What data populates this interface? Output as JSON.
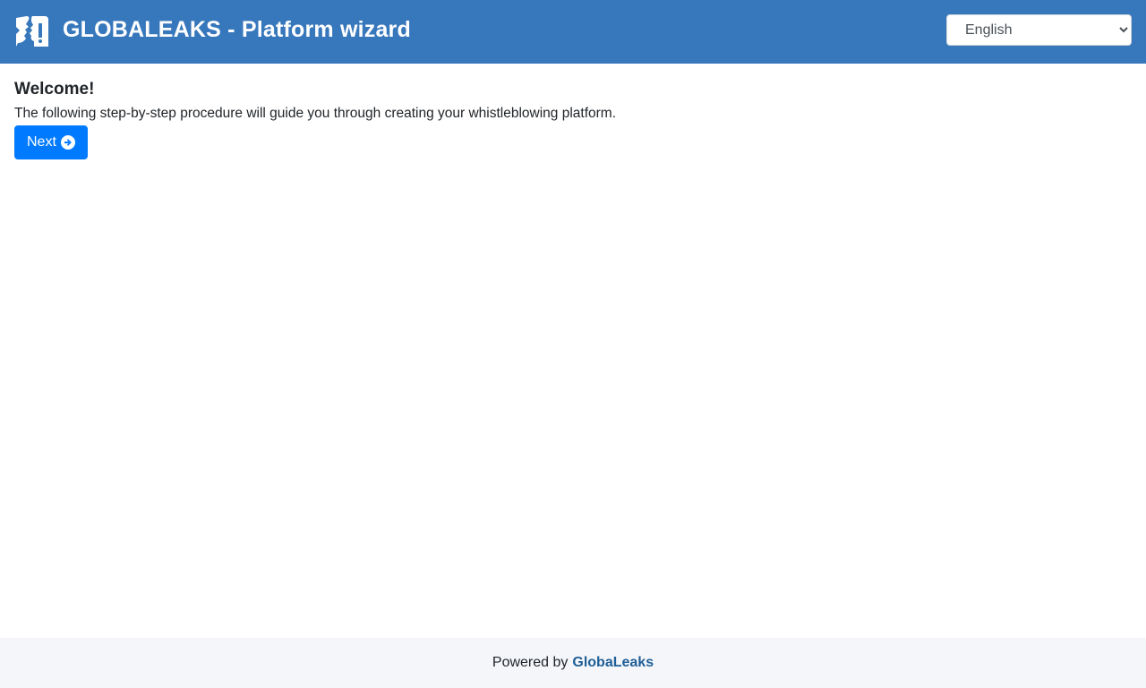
{
  "header": {
    "logo_icon": "globaleaks-logo-icon",
    "title": "GLOBALEAKS - Platform wizard",
    "background_color": "#3777bc",
    "language_select": {
      "selected": "English",
      "options": [
        "English"
      ]
    }
  },
  "main": {
    "heading": "Welcome!",
    "intro_text": "The following step-by-step procedure will guide you through creating your whistleblowing platform.",
    "next_button": {
      "label": "Next",
      "icon": "arrow-circle-right-icon",
      "color": "#007bff"
    }
  },
  "footer": {
    "prefix": "Powered by",
    "link_text": "GlobaLeaks",
    "background_color": "#f4f6fa"
  }
}
